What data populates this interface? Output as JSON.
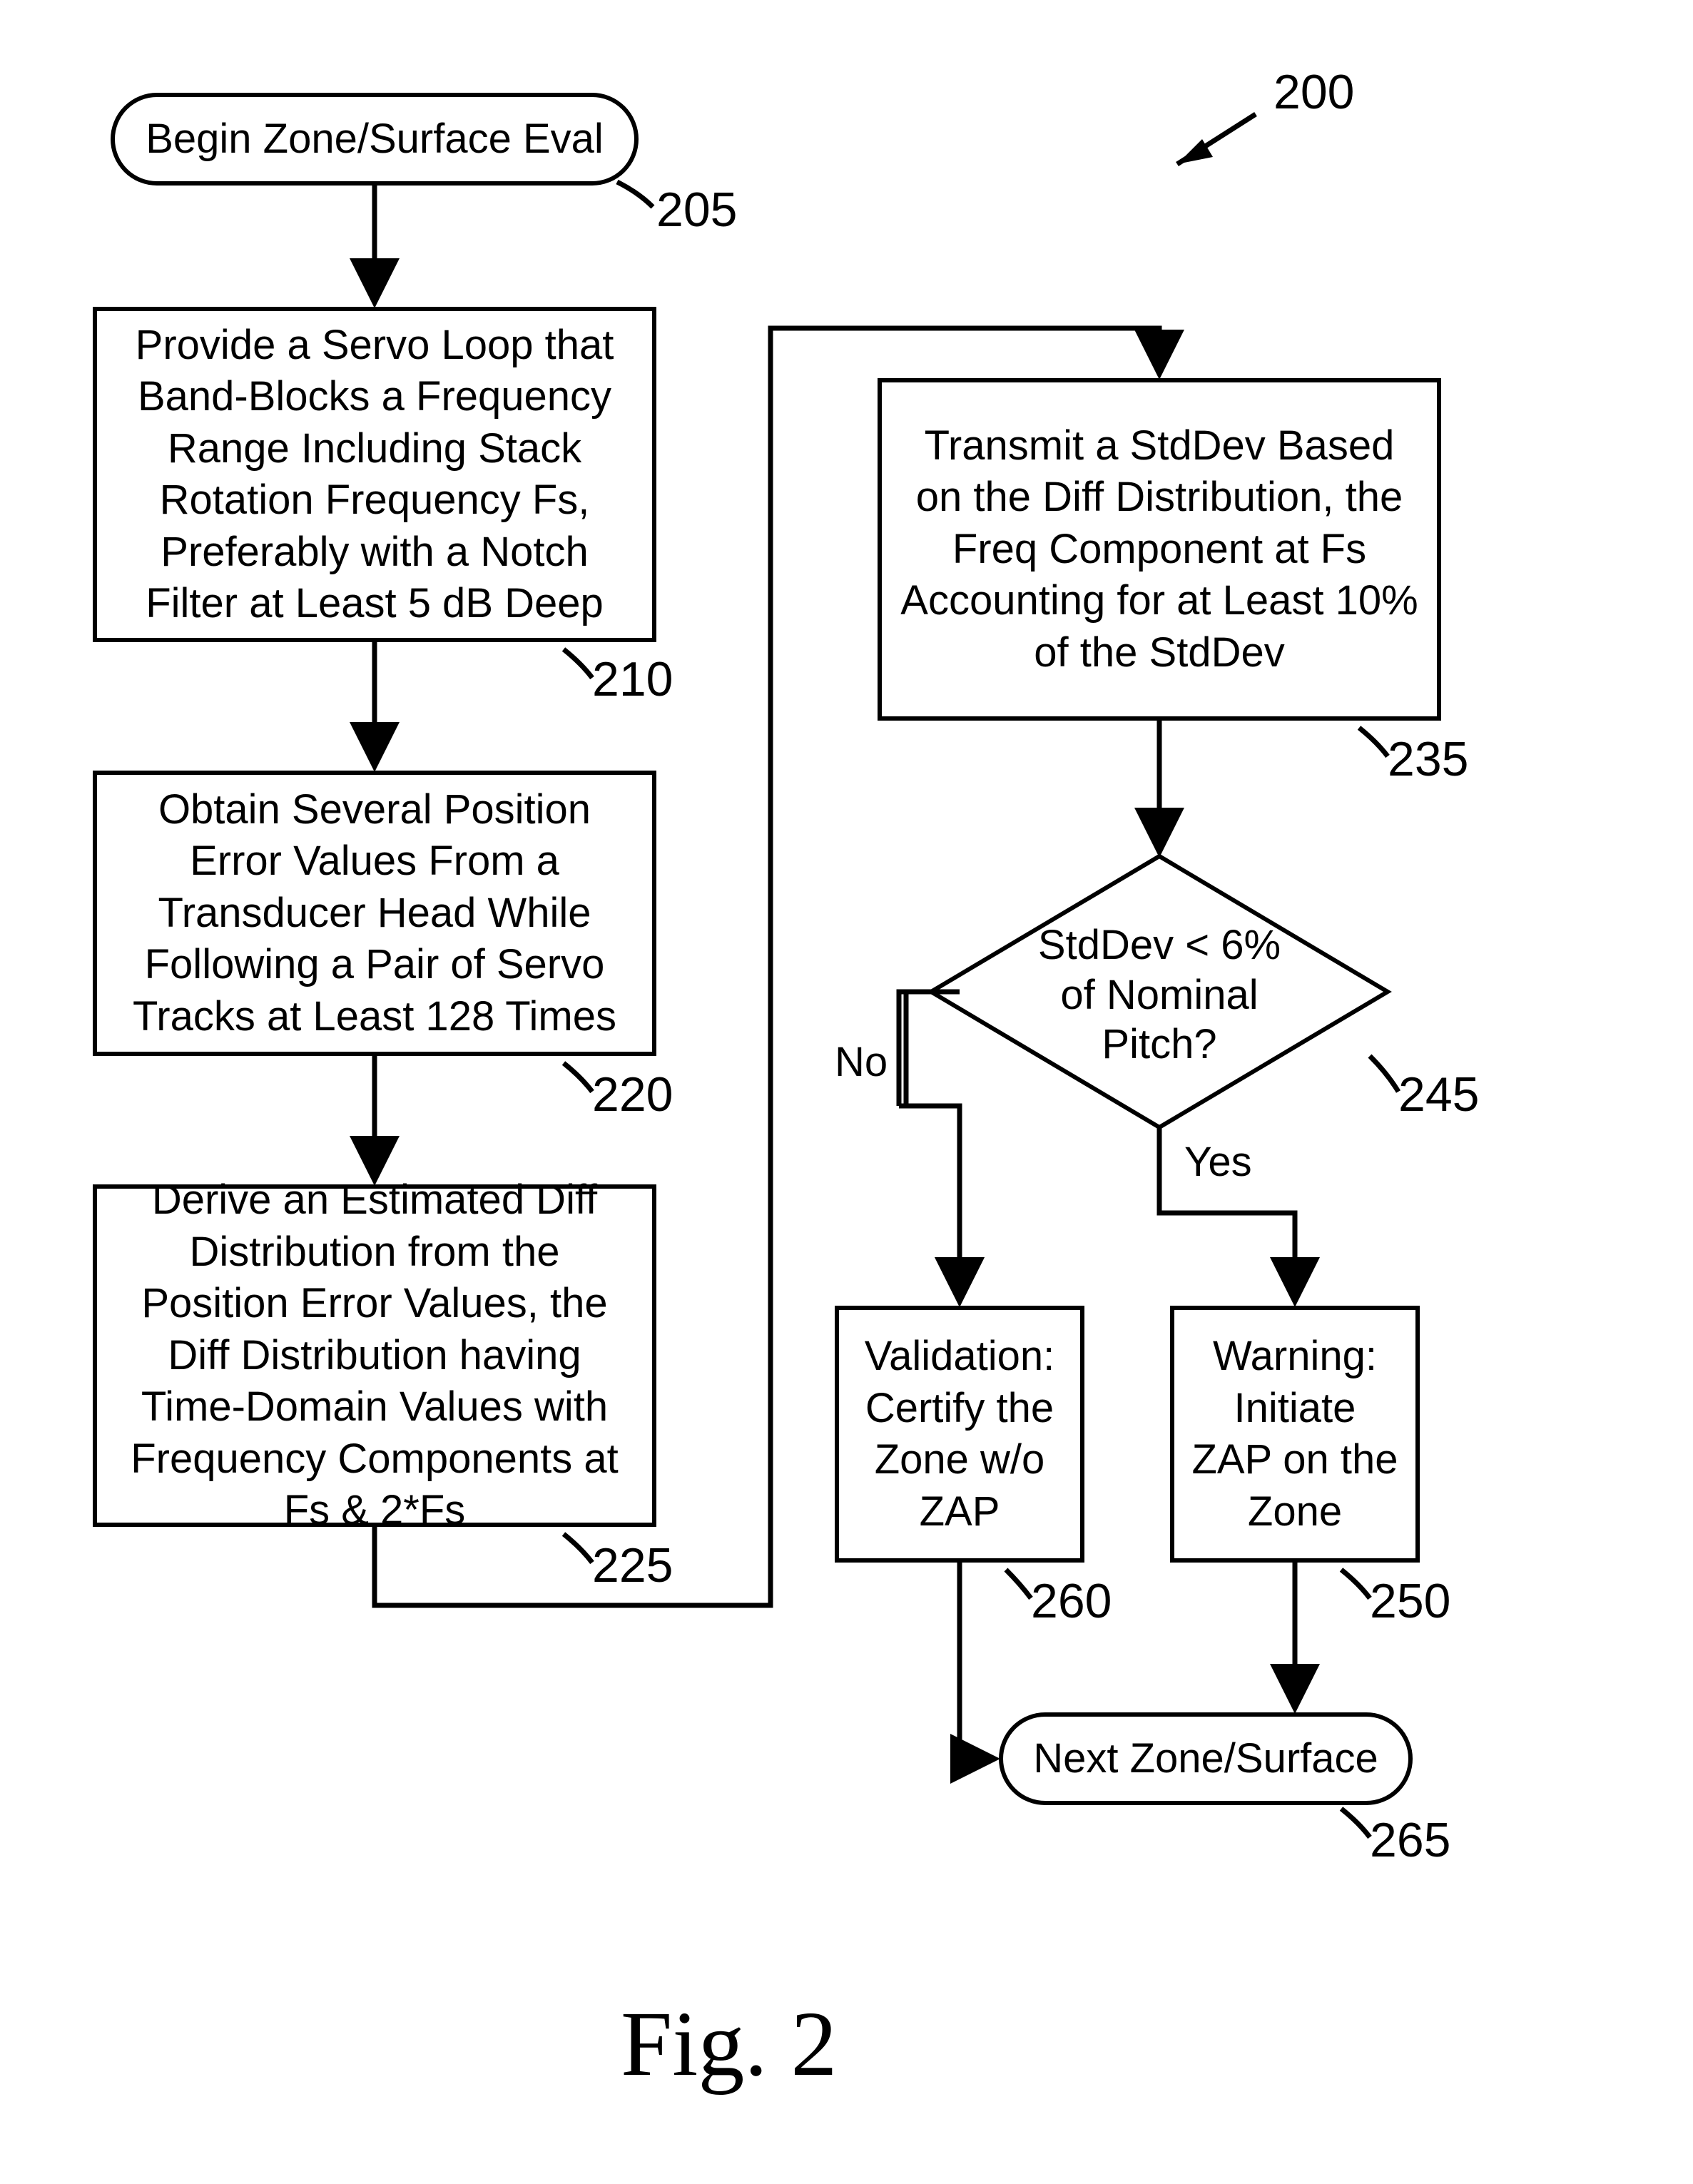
{
  "figure_ref": "200",
  "figure_caption": "Fig. 2",
  "nodes": {
    "n205": {
      "text": "Begin Zone/Surface Eval",
      "ref": "205"
    },
    "n210": {
      "text": "Provide a Servo Loop that Band-Blocks a Frequency Range Including Stack Rotation Frequency Fs, Preferably with a Notch Filter at Least 5 dB Deep",
      "ref": "210"
    },
    "n220": {
      "text": "Obtain Several Position Error Values From a Transducer Head While Following a Pair of Servo Tracks at Least 128 Times",
      "ref": "220"
    },
    "n225": {
      "text": "Derive an Estimated Diff Distribution from the Position Error Values, the Diff Distribution having Time-Domain Values with Frequency Components at Fs & 2*Fs",
      "ref": "225"
    },
    "n235": {
      "text": "Transmit a StdDev Based on the Diff Distribution, the Freq Component at Fs Accounting for at Least 10% of the StdDev",
      "ref": "235"
    },
    "n245": {
      "text": "StdDev < 6% of Nominal Pitch?",
      "ref": "245",
      "yes": "Yes",
      "no": "No"
    },
    "n260": {
      "text": "Validation: Certify the Zone w/o ZAP",
      "ref": "260"
    },
    "n250": {
      "text": "Warning: Initiate ZAP on the Zone",
      "ref": "250"
    },
    "n265": {
      "text": "Next Zone/Surface",
      "ref": "265"
    }
  },
  "chart_data": {
    "type": "flowchart",
    "title": "Fig. 2",
    "annotation_ref": "200",
    "nodes": [
      {
        "id": "205",
        "type": "terminator",
        "label": "Begin Zone/Surface Eval"
      },
      {
        "id": "210",
        "type": "process",
        "label": "Provide a Servo Loop that Band-Blocks a Frequency Range Including Stack Rotation Frequency Fs, Preferably with a Notch Filter at Least 5 dB Deep"
      },
      {
        "id": "220",
        "type": "process",
        "label": "Obtain Several Position Error Values From a Transducer Head While Following a Pair of Servo Tracks at Least 128 Times"
      },
      {
        "id": "225",
        "type": "process",
        "label": "Derive an Estimated Diff Distribution from the Position Error Values, the Diff Distribution having Time-Domain Values with Frequency Components at Fs & 2*Fs"
      },
      {
        "id": "235",
        "type": "process",
        "label": "Transmit a StdDev Based on the Diff Distribution, the Freq Component at Fs Accounting for at Least 10% of the StdDev"
      },
      {
        "id": "245",
        "type": "decision",
        "label": "StdDev < 6% of Nominal Pitch?"
      },
      {
        "id": "260",
        "type": "process",
        "label": "Validation: Certify the Zone w/o ZAP"
      },
      {
        "id": "250",
        "type": "process",
        "label": "Warning: Initiate ZAP on the Zone"
      },
      {
        "id": "265",
        "type": "terminator",
        "label": "Next Zone/Surface"
      }
    ],
    "edges": [
      {
        "from": "205",
        "to": "210"
      },
      {
        "from": "210",
        "to": "220"
      },
      {
        "from": "220",
        "to": "225"
      },
      {
        "from": "225",
        "to": "235"
      },
      {
        "from": "235",
        "to": "245"
      },
      {
        "from": "245",
        "to": "260",
        "label": "No"
      },
      {
        "from": "245",
        "to": "250",
        "label": "Yes"
      },
      {
        "from": "260",
        "to": "265"
      },
      {
        "from": "250",
        "to": "265"
      }
    ]
  }
}
